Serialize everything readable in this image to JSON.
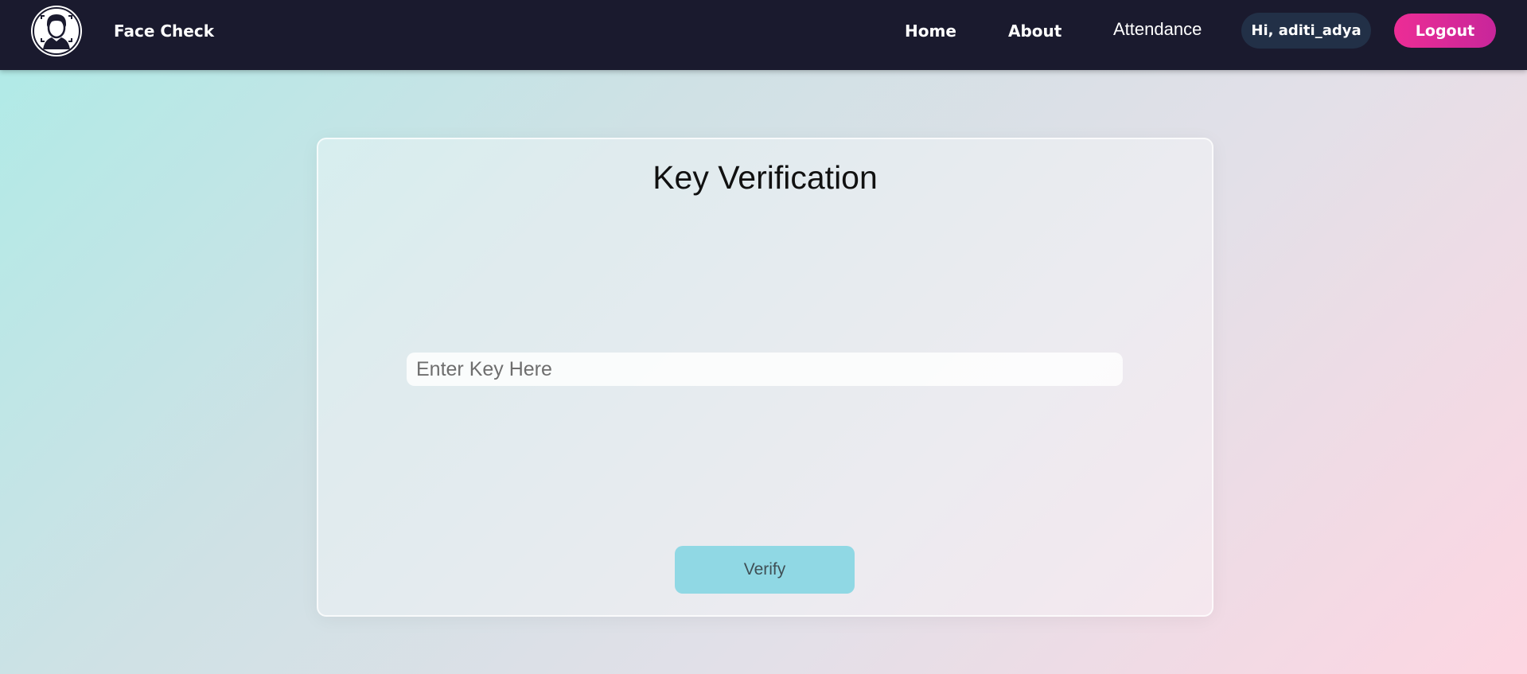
{
  "navbar": {
    "brand": "Face Check",
    "links": {
      "home": "Home",
      "about": "About",
      "attendance": "Attendance"
    },
    "greeting": "Hi, aditi_adya",
    "logout_label": "Logout"
  },
  "main": {
    "title": "Key Verification",
    "key_input": {
      "placeholder": "Enter Key Here",
      "value": ""
    },
    "verify_label": "Verify"
  },
  "icons": {
    "logo": "face-scan-icon"
  },
  "colors": {
    "navbar_bg": "#1a1a2e",
    "logout_bg": "#e6278f",
    "greeting_bg": "#223047",
    "verify_bg": "#90d8e4"
  }
}
